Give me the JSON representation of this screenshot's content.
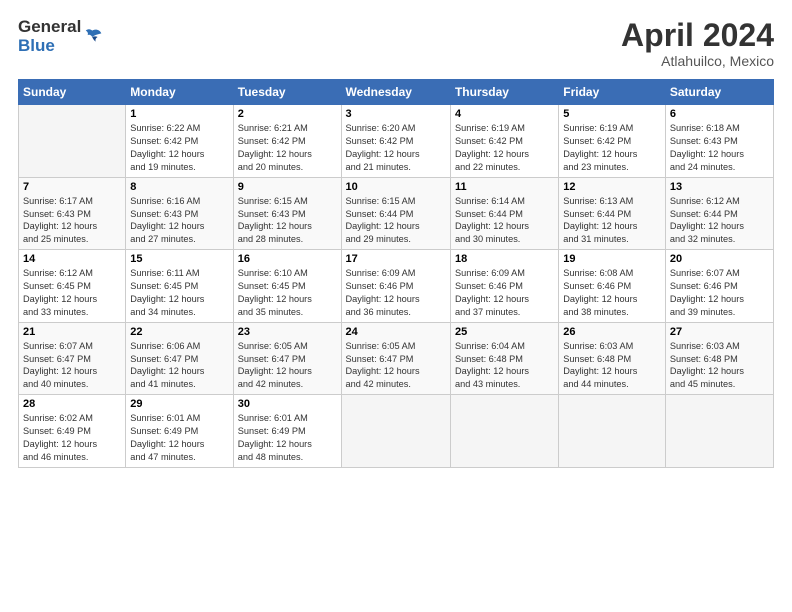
{
  "logo": {
    "general": "General",
    "blue": "Blue"
  },
  "title": "April 2024",
  "subtitle": "Atlahuilco, Mexico",
  "days_header": [
    "Sunday",
    "Monday",
    "Tuesday",
    "Wednesday",
    "Thursday",
    "Friday",
    "Saturday"
  ],
  "weeks": [
    [
      {
        "num": "",
        "info": ""
      },
      {
        "num": "1",
        "info": "Sunrise: 6:22 AM\nSunset: 6:42 PM\nDaylight: 12 hours\nand 19 minutes."
      },
      {
        "num": "2",
        "info": "Sunrise: 6:21 AM\nSunset: 6:42 PM\nDaylight: 12 hours\nand 20 minutes."
      },
      {
        "num": "3",
        "info": "Sunrise: 6:20 AM\nSunset: 6:42 PM\nDaylight: 12 hours\nand 21 minutes."
      },
      {
        "num": "4",
        "info": "Sunrise: 6:19 AM\nSunset: 6:42 PM\nDaylight: 12 hours\nand 22 minutes."
      },
      {
        "num": "5",
        "info": "Sunrise: 6:19 AM\nSunset: 6:42 PM\nDaylight: 12 hours\nand 23 minutes."
      },
      {
        "num": "6",
        "info": "Sunrise: 6:18 AM\nSunset: 6:43 PM\nDaylight: 12 hours\nand 24 minutes."
      }
    ],
    [
      {
        "num": "7",
        "info": "Sunrise: 6:17 AM\nSunset: 6:43 PM\nDaylight: 12 hours\nand 25 minutes."
      },
      {
        "num": "8",
        "info": "Sunrise: 6:16 AM\nSunset: 6:43 PM\nDaylight: 12 hours\nand 27 minutes."
      },
      {
        "num": "9",
        "info": "Sunrise: 6:15 AM\nSunset: 6:43 PM\nDaylight: 12 hours\nand 28 minutes."
      },
      {
        "num": "10",
        "info": "Sunrise: 6:15 AM\nSunset: 6:44 PM\nDaylight: 12 hours\nand 29 minutes."
      },
      {
        "num": "11",
        "info": "Sunrise: 6:14 AM\nSunset: 6:44 PM\nDaylight: 12 hours\nand 30 minutes."
      },
      {
        "num": "12",
        "info": "Sunrise: 6:13 AM\nSunset: 6:44 PM\nDaylight: 12 hours\nand 31 minutes."
      },
      {
        "num": "13",
        "info": "Sunrise: 6:12 AM\nSunset: 6:44 PM\nDaylight: 12 hours\nand 32 minutes."
      }
    ],
    [
      {
        "num": "14",
        "info": "Sunrise: 6:12 AM\nSunset: 6:45 PM\nDaylight: 12 hours\nand 33 minutes."
      },
      {
        "num": "15",
        "info": "Sunrise: 6:11 AM\nSunset: 6:45 PM\nDaylight: 12 hours\nand 34 minutes."
      },
      {
        "num": "16",
        "info": "Sunrise: 6:10 AM\nSunset: 6:45 PM\nDaylight: 12 hours\nand 35 minutes."
      },
      {
        "num": "17",
        "info": "Sunrise: 6:09 AM\nSunset: 6:46 PM\nDaylight: 12 hours\nand 36 minutes."
      },
      {
        "num": "18",
        "info": "Sunrise: 6:09 AM\nSunset: 6:46 PM\nDaylight: 12 hours\nand 37 minutes."
      },
      {
        "num": "19",
        "info": "Sunrise: 6:08 AM\nSunset: 6:46 PM\nDaylight: 12 hours\nand 38 minutes."
      },
      {
        "num": "20",
        "info": "Sunrise: 6:07 AM\nSunset: 6:46 PM\nDaylight: 12 hours\nand 39 minutes."
      }
    ],
    [
      {
        "num": "21",
        "info": "Sunrise: 6:07 AM\nSunset: 6:47 PM\nDaylight: 12 hours\nand 40 minutes."
      },
      {
        "num": "22",
        "info": "Sunrise: 6:06 AM\nSunset: 6:47 PM\nDaylight: 12 hours\nand 41 minutes."
      },
      {
        "num": "23",
        "info": "Sunrise: 6:05 AM\nSunset: 6:47 PM\nDaylight: 12 hours\nand 42 minutes."
      },
      {
        "num": "24",
        "info": "Sunrise: 6:05 AM\nSunset: 6:47 PM\nDaylight: 12 hours\nand 42 minutes."
      },
      {
        "num": "25",
        "info": "Sunrise: 6:04 AM\nSunset: 6:48 PM\nDaylight: 12 hours\nand 43 minutes."
      },
      {
        "num": "26",
        "info": "Sunrise: 6:03 AM\nSunset: 6:48 PM\nDaylight: 12 hours\nand 44 minutes."
      },
      {
        "num": "27",
        "info": "Sunrise: 6:03 AM\nSunset: 6:48 PM\nDaylight: 12 hours\nand 45 minutes."
      }
    ],
    [
      {
        "num": "28",
        "info": "Sunrise: 6:02 AM\nSunset: 6:49 PM\nDaylight: 12 hours\nand 46 minutes."
      },
      {
        "num": "29",
        "info": "Sunrise: 6:01 AM\nSunset: 6:49 PM\nDaylight: 12 hours\nand 47 minutes."
      },
      {
        "num": "30",
        "info": "Sunrise: 6:01 AM\nSunset: 6:49 PM\nDaylight: 12 hours\nand 48 minutes."
      },
      {
        "num": "",
        "info": ""
      },
      {
        "num": "",
        "info": ""
      },
      {
        "num": "",
        "info": ""
      },
      {
        "num": "",
        "info": ""
      }
    ]
  ]
}
